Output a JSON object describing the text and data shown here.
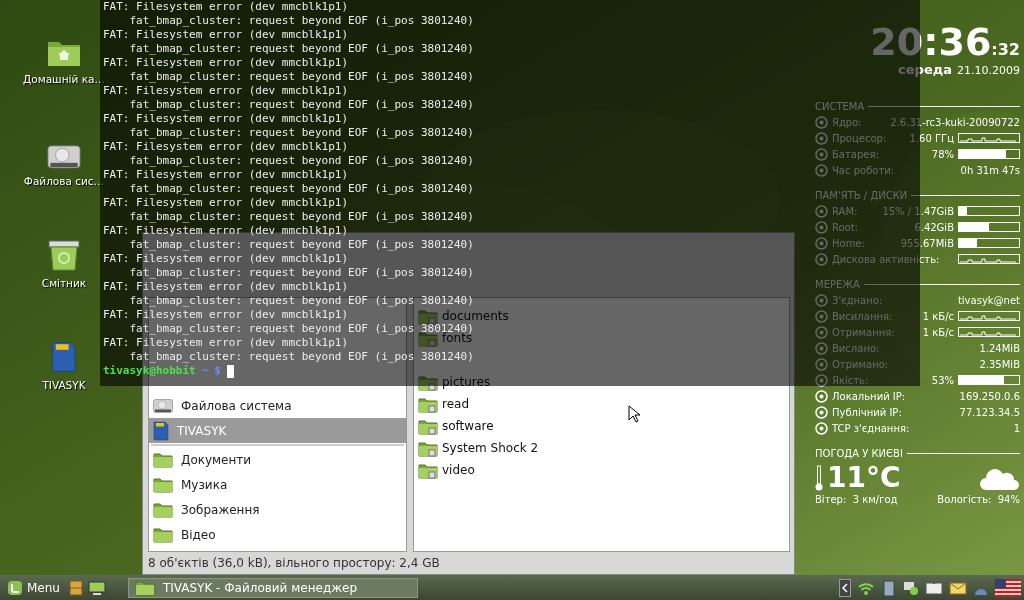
{
  "desktop_icons": [
    {
      "kind": "home",
      "label": "Домашній ка…"
    },
    {
      "kind": "drive",
      "label": "Файлова сис…"
    },
    {
      "kind": "trash",
      "label": "Смітник"
    },
    {
      "kind": "sdcard",
      "label": "TIVASYK"
    }
  ],
  "file_manager": {
    "sidebar": [
      {
        "kind": "drive",
        "label": "Файлова система",
        "selected": false
      },
      {
        "kind": "sdcard",
        "label": "TIVASYK",
        "selected": true
      },
      {
        "kind": "folder",
        "label": "Документи",
        "selected": false
      },
      {
        "kind": "folder",
        "label": "Музика",
        "selected": false
      },
      {
        "kind": "folder",
        "label": "Зображення",
        "selected": false
      },
      {
        "kind": "folder",
        "label": "Відео",
        "selected": false
      }
    ],
    "files": [
      {
        "kind": "folder",
        "name": "documents"
      },
      {
        "kind": "folder",
        "name": "fonts"
      },
      {
        "kind": "covered"
      },
      {
        "kind": "folder",
        "name": "pictures"
      },
      {
        "kind": "folder",
        "name": "read"
      },
      {
        "kind": "folder",
        "name": "software"
      },
      {
        "kind": "folder",
        "name": "System Shock 2"
      },
      {
        "kind": "folder",
        "name": "video"
      }
    ],
    "status_bar": "8 об'єктів (36,0 kB), вільного простору: 2,4 GB"
  },
  "conky": {
    "clock": {
      "time": "20:36",
      "seconds": ":32",
      "weekday": "середа",
      "date": "21.10.2009"
    },
    "sections": [
      {
        "title": "СИСТЕМА",
        "rows": [
          {
            "kind": "text",
            "label": "Ядро:",
            "value": "2.6.31-rc3-kuki-20090722"
          },
          {
            "kind": "graph",
            "label": "Процесор:",
            "value": "1.60 ГГц"
          },
          {
            "kind": "bar",
            "label": "Батарея:",
            "value": "78%",
            "level": 0.78
          },
          {
            "kind": "text",
            "label": "Час роботи:",
            "value": "0h 31m 47s"
          }
        ]
      },
      {
        "title": "ПАМ'ЯТЬ / ДИСКИ",
        "rows": [
          {
            "kind": "bar",
            "label": "RAM:",
            "value": "15% / 1.47GiB",
            "level": 0.13
          },
          {
            "kind": "bar",
            "label": "Root:",
            "value": "6.42GiB",
            "level": 0.5
          },
          {
            "kind": "bar",
            "label": "Home:",
            "value": "955.67MiB",
            "level": 0.3
          },
          {
            "kind": "graph",
            "label": "Дискова активність:"
          }
        ]
      },
      {
        "title": "МЕРЕЖА",
        "rows": [
          {
            "kind": "text",
            "label": "З'єднано:",
            "value": "tivasyk@net"
          },
          {
            "kind": "graph",
            "label": "Висилання:",
            "value": "1 кБ/с"
          },
          {
            "kind": "graph",
            "label": "Отримання:",
            "value": "1 кБ/с"
          },
          {
            "kind": "text",
            "label": "Вислано:",
            "value": "1.24MiB"
          },
          {
            "kind": "text",
            "label": "Отримано:",
            "value": "2.35MiB"
          },
          {
            "kind": "bar",
            "label": "Якість:",
            "value": "53%",
            "level": 0.75
          },
          {
            "kind": "text",
            "label": "Локальний IP:",
            "value": "169.250.0.6"
          },
          {
            "kind": "text",
            "label": "Публічний IP:",
            "value": "77.123.34.5"
          },
          {
            "kind": "text",
            "label": "TCP з'єднання:",
            "value": "1"
          }
        ]
      }
    ],
    "weather": {
      "title": "ПОГОДА У КИЄВІ",
      "temperature": "11°C",
      "wind": "Вітер:  3 км/год",
      "humidity": "Вологість:  94%"
    }
  },
  "terminal": {
    "lines": [
      "FAT: Filesystem error (dev mmcblk1p1)",
      "    fat_bmap_cluster: request beyond EOF (i_pos 3801240)",
      "FAT: Filesystem error (dev mmcblk1p1)",
      "    fat_bmap_cluster: request beyond EOF (i_pos 3801240)",
      "FAT: Filesystem error (dev mmcblk1p1)",
      "    fat_bmap_cluster: request beyond EOF (i_pos 3801240)",
      "FAT: Filesystem error (dev mmcblk1p1)",
      "    fat_bmap_cluster: request beyond EOF (i_pos 3801240)",
      "FAT: Filesystem error (dev mmcblk1p1)",
      "    fat_bmap_cluster: request beyond EOF (i_pos 3801240)",
      "FAT: Filesystem error (dev mmcblk1p1)",
      "    fat_bmap_cluster: request beyond EOF (i_pos 3801240)",
      "FAT: Filesystem error (dev mmcblk1p1)",
      "    fat_bmap_cluster: request beyond EOF (i_pos 3801240)",
      "FAT: Filesystem error (dev mmcblk1p1)",
      "    fat_bmap_cluster: request beyond EOF (i_pos 3801240)",
      "FAT: Filesystem error (dev mmcblk1p1)",
      "    fat_bmap_cluster: request beyond EOF (i_pos 3801240)",
      "FAT: Filesystem error (dev mmcblk1p1)",
      "    fat_bmap_cluster: request beyond EOF (i_pos 3801240)",
      "FAT: Filesystem error (dev mmcblk1p1)",
      "    fat_bmap_cluster: request beyond EOF (i_pos 3801240)",
      "FAT: Filesystem error (dev mmcblk1p1)",
      "    fat_bmap_cluster: request beyond EOF (i_pos 3801240)",
      "FAT: Filesystem error (dev mmcblk1p1)",
      "    fat_bmap_cluster: request beyond EOF (i_pos 3801240)"
    ],
    "prompt": {
      "user": "tivasyk@hobbit",
      "path": "~",
      "symbol": "$"
    }
  },
  "taskbar": {
    "menu": "Menu",
    "window_button": "TIVASYK - Файловий менеджер"
  }
}
